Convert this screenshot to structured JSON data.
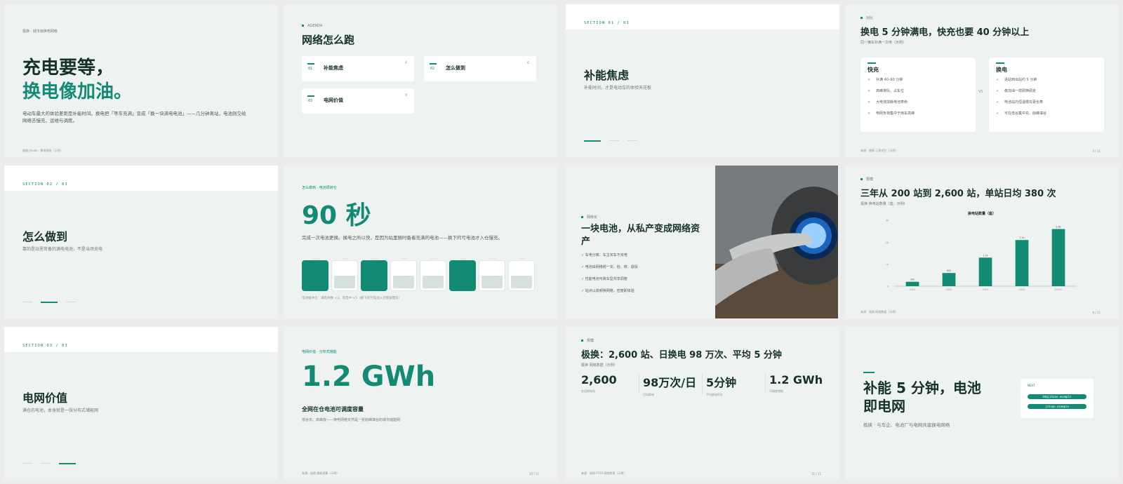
{
  "slides": {
    "s1": {
      "kicker": "极换 · 城市级换电网络",
      "title_line1": "充电要等，",
      "title_line2": "换电像加油。",
      "body": "电动车最大的体验差距是补能时间。换电把「等车充满」变成「换一块满电电池」——几分钟离站，电池则交给网络去慢充、运维与调度。",
      "footer": "极换 Jihuan · 换电网络（示例）"
    },
    "s2": {
      "kicker": "AGENDA",
      "title": "网络怎么跑",
      "items": [
        {
          "num": "01",
          "label": "补能焦虑",
          "page": "4"
        },
        {
          "num": "02",
          "label": "怎么做到",
          "page": "6"
        },
        {
          "num": "03",
          "label": "电网价值",
          "page": "9"
        }
      ]
    },
    "s3": {
      "section": "SECTION 01 / 03",
      "title": "补能焦虑",
      "sub": "补能时间，才是电动车的体验天花板"
    },
    "s4": {
      "kicker": "对比",
      "title": "换电 5 分钟满电，快充也要 40 分钟以上",
      "sub": "同一辆车补满一次电（示例）",
      "left": {
        "title": "快充",
        "items": [
          "补满 40–60 分钟",
          "高峰排队、占车位",
          "大电流损耗电池寿命",
          "电网负荷集中于用车高峰"
        ]
      },
      "vs": "VS",
      "right": {
        "title": "换电",
        "items": [
          "进站到出站约 5 分钟",
          "像加油一样即换即走",
          "电池站内恒温慢充更长寿",
          "可在低谷集中充、削峰填谷"
        ]
      },
      "footer_l": "来源：极换 示意对比（示例）",
      "footer_r": "4 / 11"
    },
    "s5": {
      "section": "SECTION 02 / 03",
      "title": "怎么做到",
      "sub": "靠的是站里常备的满电电池，不是当场充电"
    },
    "s6": {
      "kicker": "怎么做到 · 电池周转仓",
      "big": "90 秒",
      "body": "完成一次电池更换。换电之所以快，是因为站里随时备着充满的电池——换下的亏电池才入仓慢充。",
      "caption": "电池缓冲仓：满电待换 ×3，充电中 ×5（换下的亏电池入仓慢速慢充）",
      "batteries": [
        "full",
        "empty",
        "full",
        "empty",
        "empty",
        "full",
        "empty",
        "empty"
      ]
    },
    "s7": {
      "kicker": "网络化",
      "title": "一块电池，从私产变成网络资产",
      "items": [
        "车电分离：车主买车不买电",
        "电池由网络统一充、检、修、退役",
        "性能电池可跨车型共享调度",
        "站点以高频换网络，密度即体验"
      ]
    },
    "s8": {
      "kicker": "规模",
      "title": "三年从 200 站到 2,600 站，单站日均 380 次",
      "sub": "极换 换电站数量（座，示例）",
      "footer_l": "来源：极换 网络数据（示例）",
      "footer_r": "8 / 11"
    },
    "s9": {
      "section": "SECTION 03 / 03",
      "title": "电网价值",
      "sub": "满仓的电池，本身就是一张分布式储能网"
    },
    "s10": {
      "kicker": "电网价值 · 分布式储能",
      "big": "1.2 GWh",
      "title": "全网在仓电池可调度容量",
      "sub": "低谷充、高峰放——换电网络天然是一张削峰填谷的城市储能网",
      "footer_l": "来源：极换 储能测算（示例）",
      "footer_r": "10 / 11"
    },
    "s11": {
      "kicker": "规模",
      "title": "极换：2,600 站、日换电 98 万次、平均 5 分钟",
      "sub": "极换 网络数据（示例）",
      "stats": [
        {
          "value": "2,600",
          "label": "在运换电站"
        },
        {
          "value": "98万次/日",
          "label": "日均换电"
        },
        {
          "value": "5分钟",
          "label": "平均换电时长"
        },
        {
          "value": "1.2 GWh",
          "label": "可调度储能"
        }
      ],
      "footer_l": "来源：极换 FY24 网络数据（示例）",
      "footer_r": "11 / 11"
    },
    "s12": {
      "title_line1": "补能 5 分钟，电池",
      "title_line2": "即电网",
      "sub": "极换 · 与车企、电池厂与电网共建换电网络",
      "next_label": "NEXT",
      "contact1": "bd@jihuan.example",
      "contact2": "jihuan.example"
    }
  },
  "chart_data": {
    "type": "bar",
    "title": "换电站数量（座）",
    "categories": [
      "2021",
      "2022",
      "2023",
      "2024",
      "2025E"
    ],
    "values": [
      200,
      600,
      1300,
      2100,
      2600
    ],
    "value_labels": [
      "200",
      "600",
      "1.3k",
      "2.1k",
      "2.6k"
    ],
    "ytick_labels": [
      "0",
      "1k",
      "2k",
      "3k"
    ],
    "ylim": [
      0,
      3000
    ],
    "color": "#138a74"
  },
  "colors": {
    "accent": "#138a74",
    "bg": "#eef3f2",
    "text": "#16302a"
  }
}
